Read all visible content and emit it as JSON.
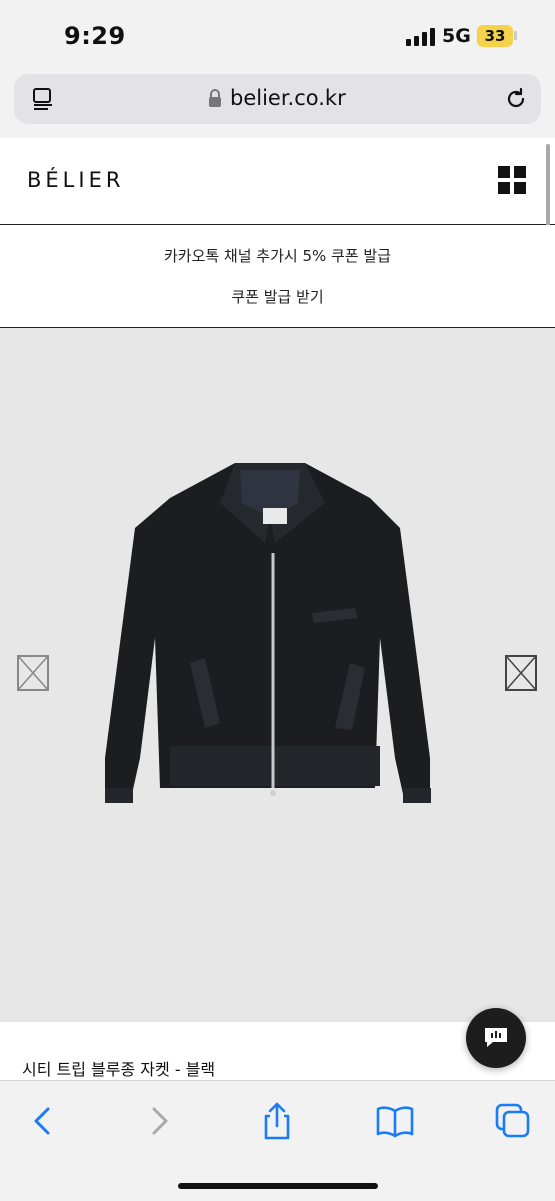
{
  "status_bar": {
    "time": "9:29",
    "network": "5G",
    "battery": "33"
  },
  "browser": {
    "url": "belier.co.kr"
  },
  "site": {
    "logo": "BÉLIER",
    "notice_line1": "카카오톡 채널 추가시 5% 쿠폰 발급",
    "notice_line2": "쿠폰 발급 받기"
  },
  "product": {
    "name": "시티 트립 블루종 자켓 - 블랙"
  },
  "colors": {
    "accent_blue": "#1a7cf5",
    "battery_yellow": "#f6d24a"
  },
  "icons": [
    "reader-icon",
    "lock-icon",
    "reload-icon",
    "menu-grid-icon",
    "image-placeholder-icon",
    "chat-icon",
    "back-icon",
    "forward-icon",
    "share-icon",
    "bookmarks-icon",
    "tabs-icon"
  ]
}
